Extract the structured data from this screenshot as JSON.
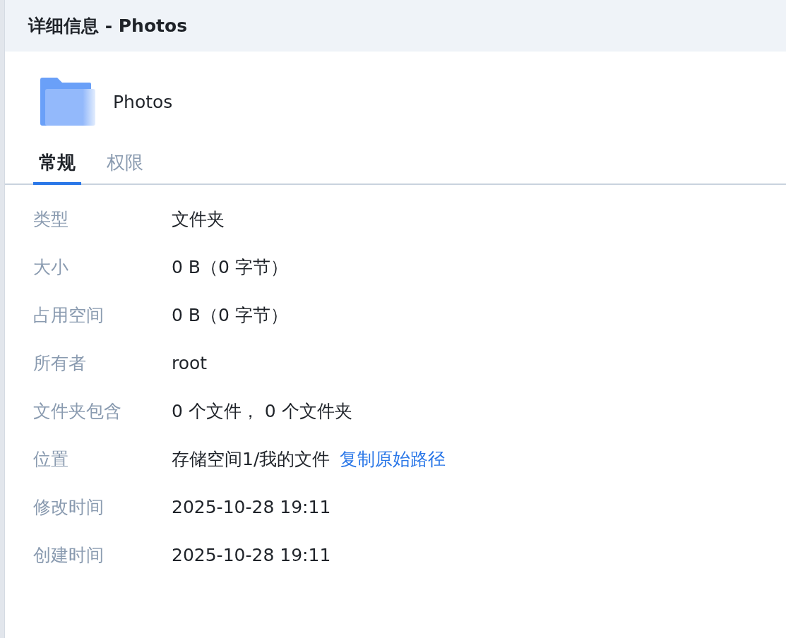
{
  "window": {
    "title": "详细信息 - Photos"
  },
  "item": {
    "name": "Photos",
    "kind": "folder"
  },
  "tabs": [
    {
      "label": "常规",
      "selected": true
    },
    {
      "label": "权限",
      "selected": false
    }
  ],
  "properties": [
    {
      "label": "类型",
      "value": "文件夹"
    },
    {
      "label": "大小",
      "value": "0 B（0 字节）"
    },
    {
      "label": "占用空间",
      "value": "0 B（0 字节）"
    },
    {
      "label": "所有者",
      "value": "root"
    },
    {
      "label": "文件夹包含",
      "value": "0 个文件， 0 个文件夹"
    },
    {
      "label": "位置",
      "value": "存储空间1/我的文件",
      "link": "复制原始路径"
    },
    {
      "label": "修改时间",
      "value": "2025-10-28 19:11"
    },
    {
      "label": "创建时间",
      "value": "2025-10-28 19:11"
    }
  ]
}
